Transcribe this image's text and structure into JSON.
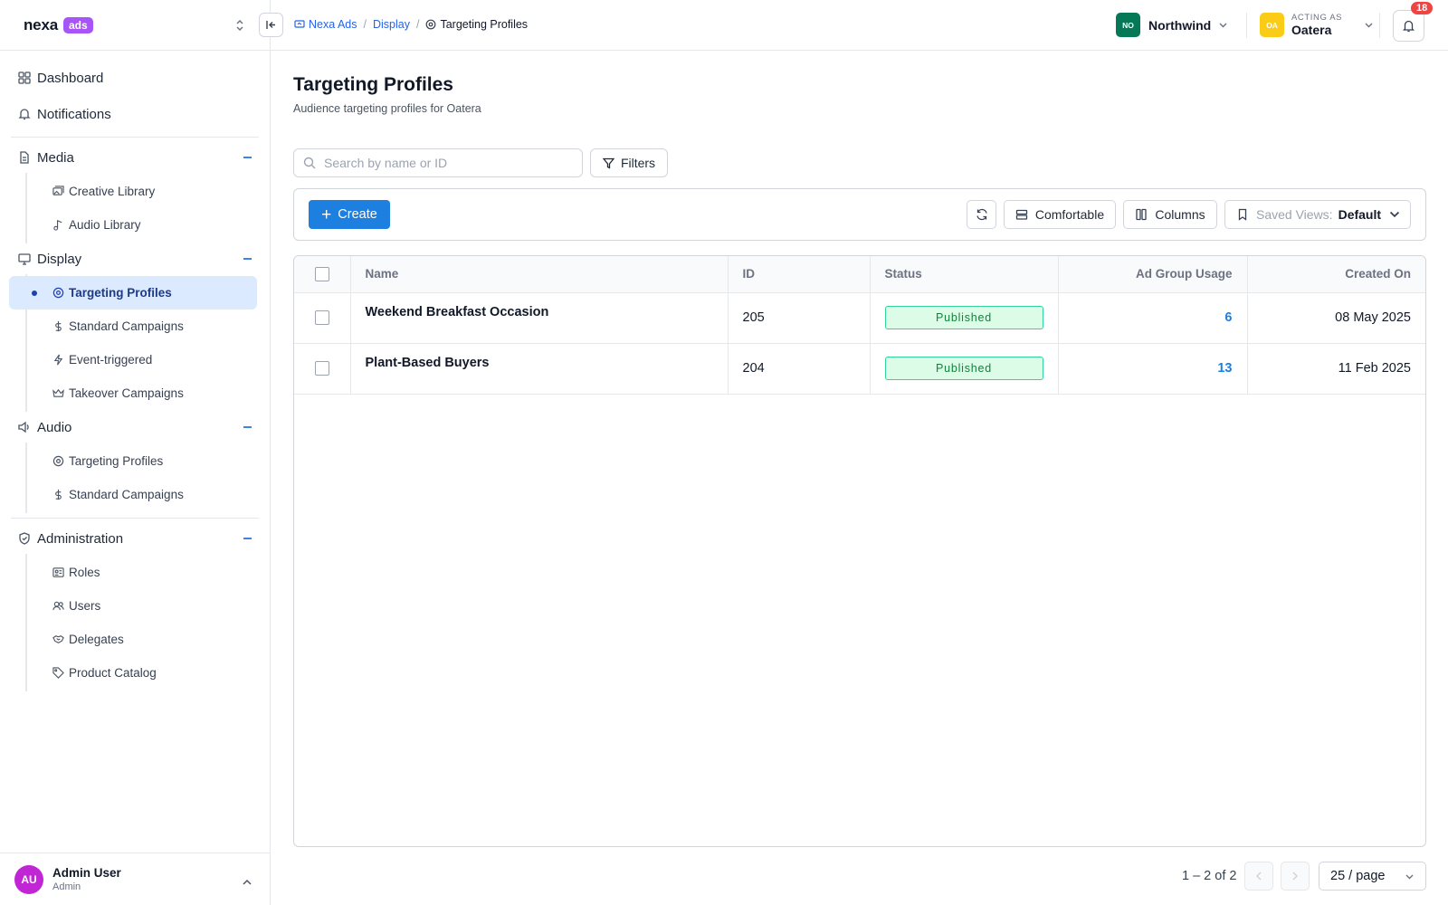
{
  "brand": {
    "name": "nexa",
    "badge": "ads"
  },
  "nav": {
    "top": [
      {
        "label": "Dashboard",
        "icon": "grid-icon"
      },
      {
        "label": "Notifications",
        "icon": "bell-icon"
      }
    ],
    "media": {
      "label": "Media",
      "items": [
        {
          "label": "Creative Library",
          "icon": "images-icon"
        },
        {
          "label": "Audio Library",
          "icon": "music-note-icon"
        }
      ]
    },
    "display": {
      "label": "Display",
      "items": [
        {
          "label": "Targeting Profiles",
          "icon": "target-icon",
          "active": true
        },
        {
          "label": "Standard Campaigns",
          "icon": "dollar-icon"
        },
        {
          "label": "Event-triggered",
          "icon": "lightning-icon"
        },
        {
          "label": "Takeover Campaigns",
          "icon": "crown-icon"
        }
      ]
    },
    "audio": {
      "label": "Audio",
      "items": [
        {
          "label": "Targeting Profiles",
          "icon": "target-icon"
        },
        {
          "label": "Standard Campaigns",
          "icon": "dollar-icon"
        }
      ]
    },
    "administration": {
      "label": "Administration",
      "items": [
        {
          "label": "Roles",
          "icon": "id-card-icon"
        },
        {
          "label": "Users",
          "icon": "users-icon"
        },
        {
          "label": "Delegates",
          "icon": "handshake-icon"
        },
        {
          "label": "Product Catalog",
          "icon": "tag-icon"
        }
      ]
    }
  },
  "user": {
    "initials": "AU",
    "name": "Admin User",
    "role": "Admin"
  },
  "breadcrumb": [
    "Nexa Ads",
    "Display",
    "Targeting Profiles"
  ],
  "org": {
    "initials": "NO",
    "name": "Northwind",
    "color": "#047857"
  },
  "acting": {
    "label": "ACTING AS",
    "initials": "OA",
    "name": "Oatera",
    "color": "#facc15"
  },
  "notifications": {
    "count": "18"
  },
  "page": {
    "title": "Targeting Profiles",
    "subtitle": "Audience targeting profiles for Oatera"
  },
  "search": {
    "placeholder": "Search by name or ID",
    "value": ""
  },
  "filters_label": "Filters",
  "toolbar": {
    "create_label": "Create",
    "density_label": "Comfortable",
    "columns_label": "Columns",
    "saved_views_label": "Saved Views:",
    "saved_views_value": "Default"
  },
  "table": {
    "headers": {
      "name": "Name",
      "id": "ID",
      "status": "Status",
      "usage": "Ad Group Usage",
      "created": "Created On"
    },
    "rows": [
      {
        "name": "Weekend Breakfast Occasion",
        "id": "205",
        "status": "Published",
        "usage": "6",
        "created": "08 May 2025"
      },
      {
        "name": "Plant-Based Buyers",
        "id": "204",
        "status": "Published",
        "usage": "13",
        "created": "11 Feb 2025"
      }
    ]
  },
  "pagination": {
    "range": "1 – 2 of 2",
    "per_page": "25 / page"
  },
  "colors": {
    "accent": "#1d7fe0",
    "active_bg": "#dbeafe",
    "published_bg": "#dcfce7",
    "published_text": "#15803d",
    "badge_red": "#ef4444",
    "brand_purple": "#a855f7"
  }
}
